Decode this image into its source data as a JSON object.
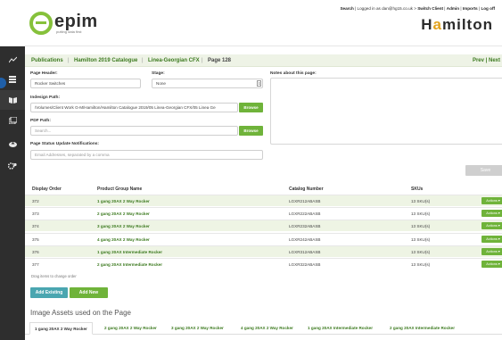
{
  "header": {
    "logo_text": "epim",
    "logo_tagline": "putting data first",
    "top_links": {
      "search": "Search",
      "logged_in": "Logged in as dan@hg15.co.uk",
      "switch_client": "Switch Client",
      "admin": "Admin",
      "imports": "Imports",
      "log_off": "Log off"
    },
    "brand_pre": "H",
    "brand_accent": "a",
    "brand_post": "milton"
  },
  "sidebar": {
    "icons": [
      "chart-icon",
      "layers-icon",
      "book-icon",
      "catalogue-icon",
      "upload-icon",
      "settings-icon"
    ]
  },
  "breadcrumb": {
    "items": [
      "Publications",
      "Hamilton 2019 Catalogue",
      "Linea-Georgian CFX",
      "Page 128"
    ],
    "separator": "|",
    "prev_next": "Prev | Next"
  },
  "form": {
    "page_header_label": "Page Header:",
    "page_header_value": "Rocker Switches",
    "stage_label": "Stage:",
    "stage_value": "None",
    "notes_label": "Notes about this page:",
    "indesign_label": "Indesign Path:",
    "indesign_value": "/Volumes/Client Work G-M/Hamilton/Hamilton Catalogue 2019/05 Linea-Georgian CFX/05 Linea Ge",
    "browse_label": "Browse",
    "pdf_label": "PDF Path:",
    "pdf_placeholder": "Search...",
    "status_label": "Page Status Update Notifications:",
    "status_placeholder": "Email Addresses, separated by a comma",
    "save_label": "Save"
  },
  "table": {
    "headers": [
      "Display Order",
      "Product Group Name",
      "Catalog Number",
      "SKUs"
    ],
    "rows": [
      {
        "order": "372",
        "name": "1 gang 20AX 2 Way Rocker",
        "catalog": "LGXR212ABASB",
        "skus": "13 SKU(s)"
      },
      {
        "order": "373",
        "name": "2 gang 20AX 2 Way Rocker",
        "catalog": "LGXR222ABASB",
        "skus": "13 SKU(s)"
      },
      {
        "order": "374",
        "name": "3 gang 20AX 2 Way Rocker",
        "catalog": "LGXR232ABASB",
        "skus": "13 SKU(s)"
      },
      {
        "order": "375",
        "name": "4 gang 20AX 2 Way Rocker",
        "catalog": "LGXR242ABASB",
        "skus": "13 SKU(s)"
      },
      {
        "order": "376",
        "name": "1 gang 20AX Intermediate Rocker",
        "catalog": "LGXR312ABASB",
        "skus": "13 SKU(s)"
      },
      {
        "order": "377",
        "name": "2 gang 20AX Intermediate Rocker",
        "catalog": "LGXR322ABASB",
        "skus": "13 SKU(s)"
      }
    ],
    "actions_label": "Actions ▾",
    "drag_note": "Drag items to change order"
  },
  "buttons": {
    "add_existing": "Add Existing",
    "add_new": "Add New"
  },
  "colors": {
    "accent_green": "#6fb33a",
    "add_existing": "#4aa6b0",
    "sidebar_bg": "#2e2e2e"
  },
  "image_assets": {
    "title": "Image Assets used on the Page",
    "tabs": [
      "1 gang 20AX 2 Way Rocker",
      "2 gang 20AX 2 Way Rocker",
      "3 gang 20AX 2 Way Rocker",
      "4 gang 20AX 2 Way Rocker",
      "1 gang 20AX Intermediate Rocker",
      "2 gang 20AX Intermediate Rocker"
    ]
  }
}
